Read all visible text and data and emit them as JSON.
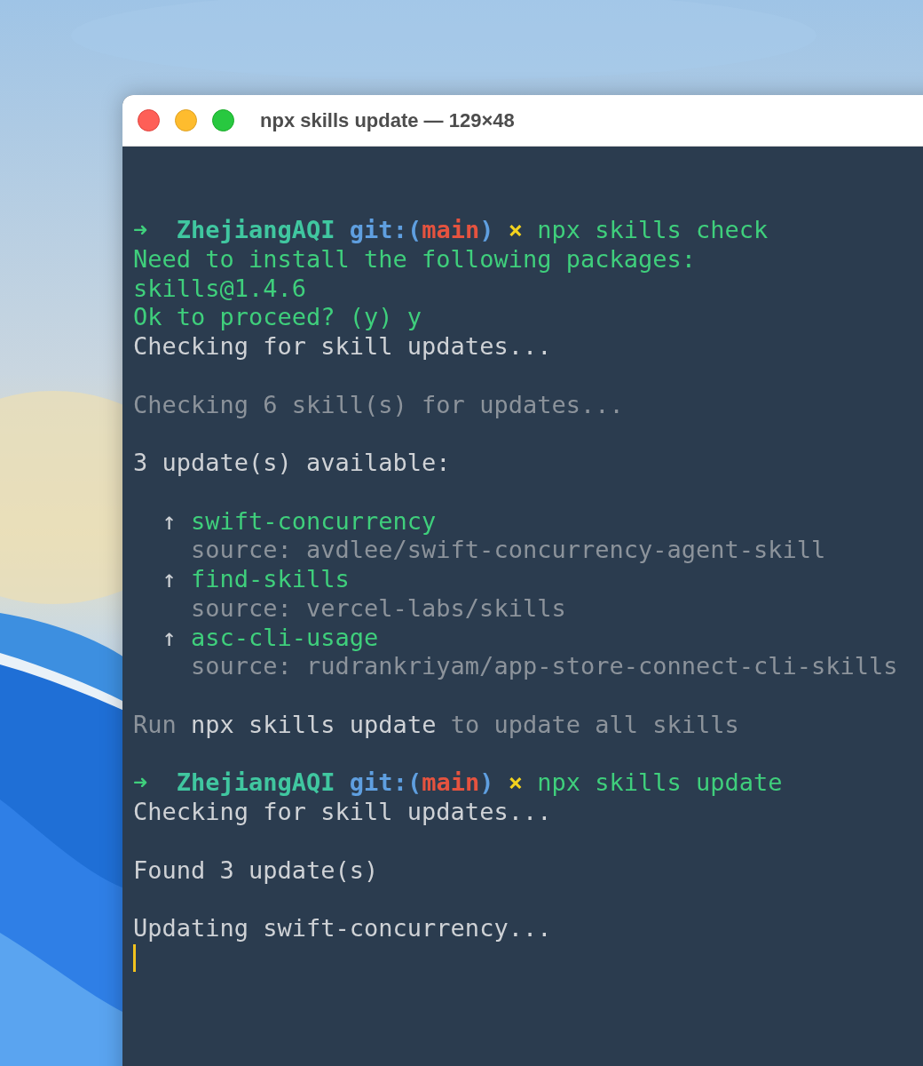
{
  "window": {
    "title": "npx skills update — 129×48"
  },
  "terminal": {
    "cursor": true,
    "lines": [
      {
        "kind": "prompt",
        "arrow": "➜",
        "dir": "ZhejiangAQI",
        "git_open": "git:(",
        "branch": "main",
        "git_close": ")",
        "dirty": "×",
        "command": "npx skills check"
      },
      {
        "kind": "text",
        "color": "#3fcf7c",
        "text": "Need to install the following packages:"
      },
      {
        "kind": "text",
        "color": "#3fcf7c",
        "text": "skills@1.4.6"
      },
      {
        "kind": "text",
        "color": "#3fcf7c",
        "text": "Ok to proceed? (y) y"
      },
      {
        "kind": "text",
        "color": "#cfd2d6",
        "text": "Checking for skill updates..."
      },
      {
        "kind": "blank"
      },
      {
        "kind": "text",
        "color": "#8c939b",
        "text": "Checking 6 skill(s) for updates..."
      },
      {
        "kind": "blank"
      },
      {
        "kind": "text",
        "color": "#cfd2d6",
        "text": "3 update(s) available:"
      },
      {
        "kind": "blank"
      },
      {
        "kind": "update",
        "arrow": "↑",
        "name": "swift-concurrency",
        "source": "source: avdlee/swift-concurrency-agent-skill"
      },
      {
        "kind": "update",
        "arrow": "↑",
        "name": "find-skills",
        "source": "source: vercel-labs/skills"
      },
      {
        "kind": "update",
        "arrow": "↑",
        "name": "asc-cli-usage",
        "source": "source: rudrankriyam/app-store-connect-cli-skills"
      },
      {
        "kind": "blank"
      },
      {
        "kind": "mixed",
        "segments": [
          {
            "color": "#8c939b",
            "text": "Run"
          },
          {
            "color": "#cfd2d6",
            "text": "npx skills update"
          },
          {
            "color": "#8c939b",
            "text": "to update all skills"
          }
        ]
      },
      {
        "kind": "blank"
      },
      {
        "kind": "prompt",
        "arrow": "➜",
        "dir": "ZhejiangAQI",
        "git_open": "git:(",
        "branch": "main",
        "git_close": ")",
        "dirty": "×",
        "command": "npx skills update"
      },
      {
        "kind": "text",
        "color": "#cfd2d6",
        "text": "Checking for skill updates..."
      },
      {
        "kind": "blank"
      },
      {
        "kind": "text",
        "color": "#cfd2d6",
        "text": "Found 3 update(s)"
      },
      {
        "kind": "blank"
      },
      {
        "kind": "text",
        "color": "#cfd2d6",
        "text": "Updating swift-concurrency..."
      }
    ]
  }
}
